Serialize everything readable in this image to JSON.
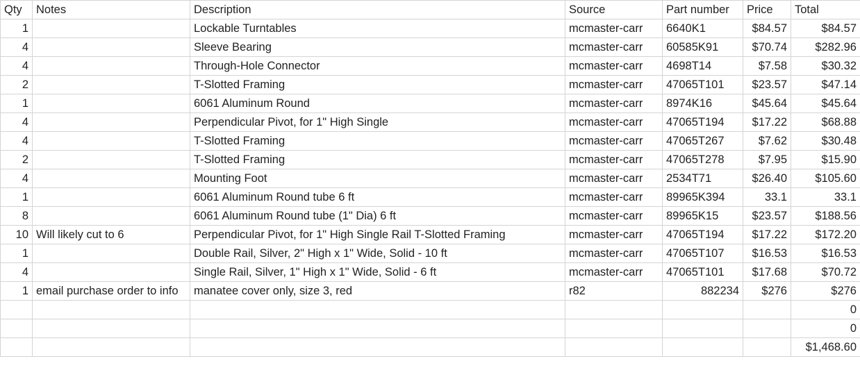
{
  "headers": {
    "qty": "Qty",
    "notes": "Notes",
    "description": "Description",
    "source": "Source",
    "part_number": "Part number",
    "price": "Price",
    "total": "Total"
  },
  "rows": [
    {
      "qty": "1",
      "notes": "",
      "description": "Lockable Turntables",
      "source": "mcmaster-carr",
      "part_number": "6640K1",
      "price": "$84.57",
      "total": "$84.57"
    },
    {
      "qty": "4",
      "notes": "",
      "description": "Sleeve Bearing",
      "source": "mcmaster-carr",
      "part_number": "60585K91",
      "price": "$70.74",
      "total": "$282.96"
    },
    {
      "qty": "4",
      "notes": "",
      "description": "Through-Hole Connector",
      "source": "mcmaster-carr",
      "part_number": "4698T14",
      "price": "$7.58",
      "total": "$30.32"
    },
    {
      "qty": "2",
      "notes": "",
      "description": "T-Slotted Framing",
      "source": "mcmaster-carr",
      "part_number": "47065T101",
      "price": "$23.57",
      "total": "$47.14"
    },
    {
      "qty": "1",
      "notes": "",
      "description": "6061 Aluminum Round",
      "source": "mcmaster-carr",
      "part_number": "8974K16",
      "price": "$45.64",
      "total": "$45.64"
    },
    {
      "qty": "4",
      "notes": "",
      "description": "Perpendicular Pivot, for 1\" High Single",
      "source": "mcmaster-carr",
      "part_number": "47065T194",
      "price": "$17.22",
      "total": "$68.88"
    },
    {
      "qty": "4",
      "notes": "",
      "description": "T-Slotted Framing",
      "source": "mcmaster-carr",
      "part_number": "47065T267",
      "price": "$7.62",
      "total": "$30.48"
    },
    {
      "qty": "2",
      "notes": "",
      "description": "T-Slotted Framing",
      "source": "mcmaster-carr",
      "part_number": "47065T278",
      "price": "$7.95",
      "total": "$15.90"
    },
    {
      "qty": "4",
      "notes": "",
      "description": "Mounting Foot",
      "source": "mcmaster-carr",
      "part_number": "2534T71",
      "price": "$26.40",
      "total": "$105.60"
    },
    {
      "qty": "1",
      "notes": "",
      "description": "6061 Aluminum Round tube  6 ft",
      "source": "mcmaster-carr",
      "part_number": "89965K394",
      "price": "33.1",
      "total": "33.1"
    },
    {
      "qty": "8",
      "notes": "",
      "description": "6061 Aluminum Round tube (1\" Dia) 6 ft",
      "source": "mcmaster-carr",
      "part_number": "89965K15",
      "price": "$23.57",
      "total": "$188.56"
    },
    {
      "qty": "10",
      "notes": "Will likely cut to 6",
      "description": "Perpendicular Pivot, for 1\" High Single Rail T-Slotted Framing",
      "source": "mcmaster-carr",
      "part_number": "47065T194",
      "price": "$17.22",
      "total": "$172.20"
    },
    {
      "qty": "1",
      "notes": "",
      "description": "Double Rail, Silver, 2\" High x 1\" Wide, Solid - 10 ft",
      "source": "mcmaster-carr",
      "part_number": "47065T107",
      "price": "$16.53",
      "total": "$16.53"
    },
    {
      "qty": "4",
      "notes": "",
      "description": "Single Rail, Silver, 1\" High x 1\" Wide, Solid - 6 ft",
      "source": "mcmaster-carr",
      "part_number": "47065T101",
      "price": "$17.68",
      "total": "$70.72"
    },
    {
      "qty": "1",
      "notes": "email purchase order to info",
      "description": "manatee cover only, size 3, red",
      "source": "r82",
      "part_number": "882234",
      "price": "$276",
      "total": "$276"
    },
    {
      "qty": "",
      "notes": "",
      "description": "",
      "source": "",
      "part_number": "",
      "price": "",
      "total": "0"
    },
    {
      "qty": "",
      "notes": "",
      "description": "",
      "source": "",
      "part_number": "",
      "price": "",
      "total": "0"
    },
    {
      "qty": "",
      "notes": "",
      "description": "",
      "source": "",
      "part_number": "",
      "price": "",
      "total": "$1,468.60"
    }
  ]
}
